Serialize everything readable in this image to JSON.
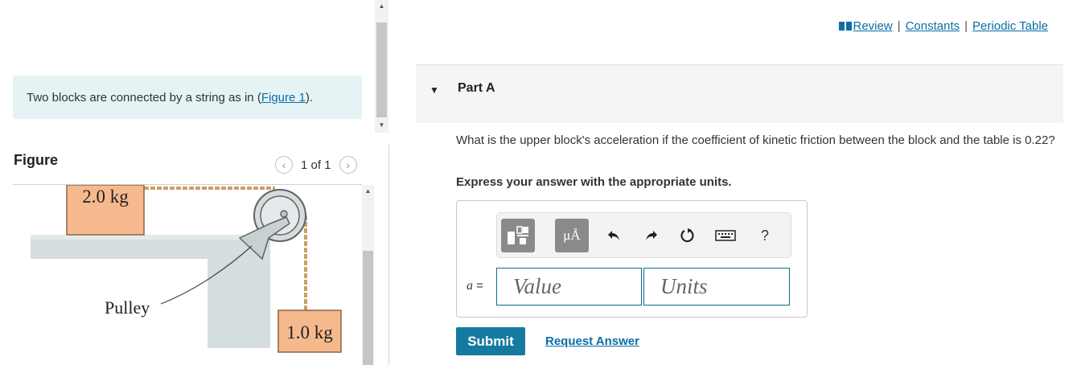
{
  "intro": {
    "text": "Two blocks are connected by a string as in (",
    "link": "Figure 1",
    "suffix": ")."
  },
  "figure": {
    "heading": "Figure",
    "page_indicator": "1 of 1",
    "upper_block_label": "2.0 kg",
    "lower_block_label": "1.0 kg",
    "pulley_label": "Pulley"
  },
  "top_links": {
    "review": "Review",
    "constants": "Constants",
    "periodic_table": "Periodic Table",
    "separator": "|"
  },
  "part": {
    "title": "Part A",
    "question": "What is the upper block's acceleration if the coefficient of kinetic friction between the block and the table is 0.22?",
    "instruction": "Express your answer with the appropriate units."
  },
  "answer": {
    "variable": "a",
    "equals": "=",
    "value_placeholder": "Value",
    "units_placeholder": "Units",
    "toolbar": {
      "units_button": "μÅ",
      "help": "?",
      "icons": [
        "templates-icon",
        "units-icon",
        "undo-icon",
        "redo-icon",
        "reset-icon",
        "keyboard-icon",
        "help-icon"
      ]
    }
  },
  "actions": {
    "submit": "Submit",
    "request_answer": "Request Answer"
  },
  "colors": {
    "accent": "#157aa0",
    "link": "#0b6ea6",
    "intro_bg": "#e6f3f5",
    "block_fill": "#f6b98e"
  }
}
